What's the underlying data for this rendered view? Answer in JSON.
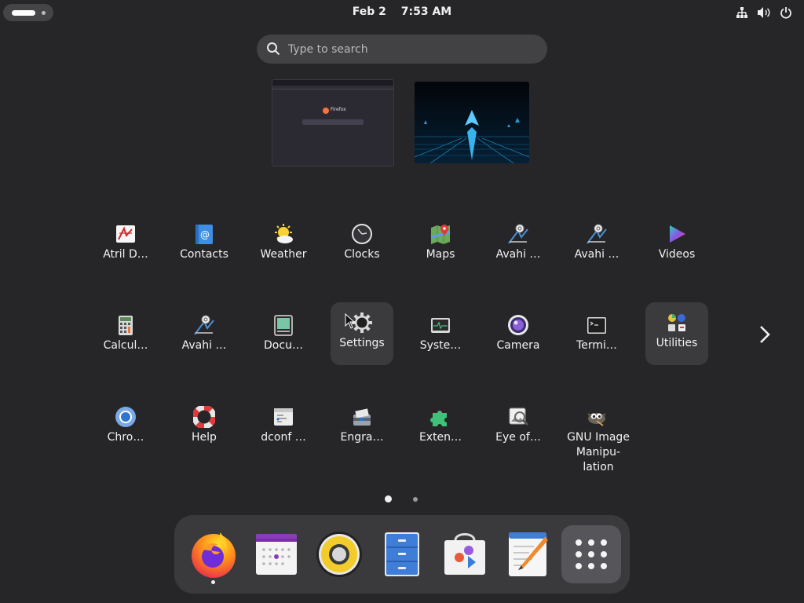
{
  "topbar": {
    "date": "Feb 2",
    "time": "7:53 AM",
    "tray_icons": [
      "network-icon",
      "volume-icon",
      "power-icon"
    ]
  },
  "search": {
    "placeholder": "Type to search"
  },
  "windows": [
    {
      "name": "firefox-window-thumbnail",
      "label": "Firefox"
    },
    {
      "name": "terminal-window-thumbnail",
      "label": ""
    }
  ],
  "apps": [
    {
      "label": "Atril D…",
      "icon": "atril-icon"
    },
    {
      "label": "Contacts",
      "icon": "contacts-icon"
    },
    {
      "label": "Weather",
      "icon": "weather-icon"
    },
    {
      "label": "Clocks",
      "icon": "clocks-icon"
    },
    {
      "label": "Maps",
      "icon": "maps-icon"
    },
    {
      "label": "Avahi …",
      "icon": "avahi-icon"
    },
    {
      "label": "Avahi …",
      "icon": "avahi-icon"
    },
    {
      "label": "Videos",
      "icon": "videos-icon"
    },
    {
      "label": "Calcul…",
      "icon": "calculator-icon"
    },
    {
      "label": "Avahi …",
      "icon": "avahi-icon"
    },
    {
      "label": "Docu…",
      "icon": "document-scanner-icon"
    },
    {
      "label": "Settings",
      "icon": "settings-icon"
    },
    {
      "label": "Syste…",
      "icon": "system-monitor-icon"
    },
    {
      "label": "Camera",
      "icon": "camera-icon"
    },
    {
      "label": "Termi…",
      "icon": "terminal-icon"
    },
    {
      "label": "Utilities",
      "icon": "utilities-folder-icon"
    },
    {
      "label": "Chro…",
      "icon": "chromium-icon"
    },
    {
      "label": "Help",
      "icon": "help-icon"
    },
    {
      "label": "dconf …",
      "icon": "dconf-icon"
    },
    {
      "label": "Engra…",
      "icon": "engrampa-icon"
    },
    {
      "label": "Exten…",
      "icon": "extensions-icon"
    },
    {
      "label": "Eye of…",
      "icon": "eye-of-gnome-icon"
    },
    {
      "label": "GNU Image Manipu-lation",
      "icon": "gimp-icon"
    }
  ],
  "pages": {
    "current": 1,
    "total": 2
  },
  "dash": [
    {
      "name": "firefox",
      "icon": "firefox-icon",
      "running": true
    },
    {
      "name": "calendar",
      "icon": "calendar-icon",
      "running": false
    },
    {
      "name": "rhythmbox",
      "icon": "speaker-icon",
      "running": false
    },
    {
      "name": "files",
      "icon": "files-cabinet-icon",
      "running": false
    },
    {
      "name": "software",
      "icon": "software-store-icon",
      "running": false
    },
    {
      "name": "text-editor",
      "icon": "text-editor-icon",
      "running": false
    },
    {
      "name": "show-apps",
      "icon": "app-grid-icon",
      "running": false
    }
  ],
  "colors": {
    "background": "#262628",
    "panel": "#3a3a3d",
    "highlight": "#3b3b3e",
    "accent": "#ff7139"
  }
}
